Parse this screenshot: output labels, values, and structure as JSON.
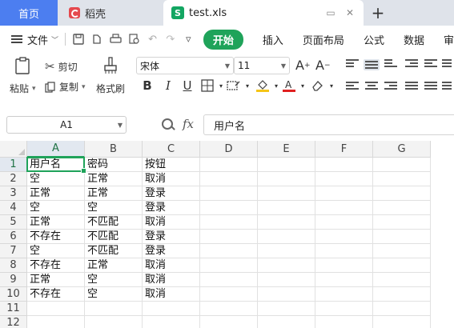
{
  "tabs": {
    "home": "首页",
    "wps": "稻壳",
    "file": "test.xls",
    "file_logo": "S",
    "new_tab": "+"
  },
  "menu": {
    "file": "文件",
    "start": "开始",
    "insert": "插入",
    "page_layout": "页面布局",
    "formula": "公式",
    "data": "数据",
    "review": "审"
  },
  "ribbon": {
    "paste": "粘贴",
    "cut": "剪切",
    "copy": "复制",
    "format_painter": "格式刷",
    "font_name": "宋体",
    "font_size": "11"
  },
  "formula_bar": {
    "cell_ref": "A1",
    "fx": "fx",
    "content": "用户名"
  },
  "sheet": {
    "columns": [
      "A",
      "B",
      "C",
      "D",
      "E",
      "F",
      "G"
    ],
    "rows": [
      "1",
      "2",
      "3",
      "4",
      "5",
      "6",
      "7",
      "8",
      "9",
      "10",
      "11",
      "12"
    ],
    "cells": [
      [
        "用户名",
        "密码",
        "按钮"
      ],
      [
        "空",
        "正常",
        "取消"
      ],
      [
        "正常",
        "正常",
        "登录"
      ],
      [
        "空",
        "空",
        "登录"
      ],
      [
        "正常",
        "不匹配",
        "取消"
      ],
      [
        "不存在",
        "不匹配",
        "登录"
      ],
      [
        "空",
        "不匹配",
        "登录"
      ],
      [
        "不存在",
        "正常",
        "取消"
      ],
      [
        "正常",
        "空",
        "取消"
      ],
      [
        "不存在",
        "空",
        "取消"
      ]
    ]
  },
  "colors": {
    "accent_green": "#1fa35a",
    "home_tab": "#4c7ef0"
  }
}
